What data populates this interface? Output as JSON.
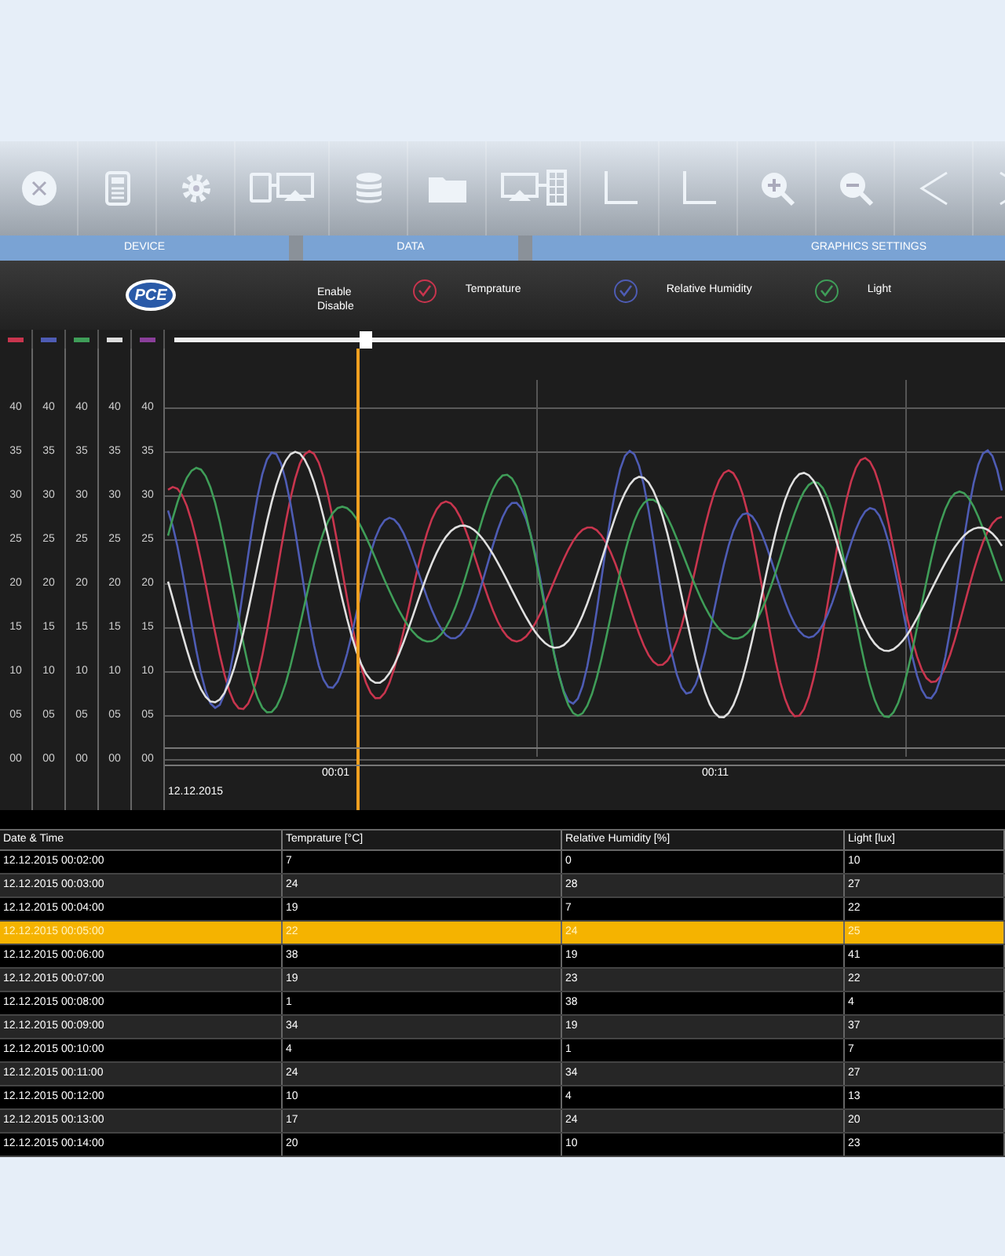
{
  "sections": [
    "DEVICE",
    "DATA",
    "GRAPHICS SETTINGS"
  ],
  "logo_text": "PCE",
  "enable_label": "Enable",
  "disable_label": "Disable",
  "series": [
    {
      "name": "Temprature",
      "color": "#c8354e",
      "checked": true
    },
    {
      "name": "Relative Humidity",
      "color": "#4e5cb4",
      "checked": true
    },
    {
      "name": "Light",
      "color": "#3f9d58",
      "checked": true
    }
  ],
  "slider": {
    "level": 0.23
  },
  "axis_columns": [
    {
      "color": "#c8354e",
      "ticks": [
        "40",
        "35",
        "30",
        "25",
        "20",
        "15",
        "10",
        "05",
        "00"
      ]
    },
    {
      "color": "#4e5cb4",
      "ticks": [
        "40",
        "35",
        "30",
        "25",
        "20",
        "15",
        "10",
        "05",
        "00"
      ]
    },
    {
      "color": "#3f9d58",
      "ticks": [
        "40",
        "35",
        "30",
        "25",
        "20",
        "15",
        "10",
        "05",
        "00"
      ]
    },
    {
      "color": "#dddddd",
      "ticks": [
        "40",
        "35",
        "30",
        "25",
        "20",
        "15",
        "10",
        "05",
        "00"
      ]
    },
    {
      "color": "#8a3f9a",
      "ticks": [
        "40",
        "35",
        "30",
        "25",
        "20",
        "15",
        "10",
        "05",
        "00"
      ]
    }
  ],
  "time_labels": [
    "00:01",
    "00:11"
  ],
  "date_label": "12.12.2015",
  "table": {
    "columns": [
      "Date & Time",
      "Temprature [°C]",
      "Relative Humidity [%]",
      "Light [lux]"
    ],
    "rows": [
      {
        "cells": [
          "12.12.2015 00:02:00",
          "7",
          "0",
          "10"
        ],
        "selected": false
      },
      {
        "cells": [
          "12.12.2015 00:03:00",
          "24",
          "28",
          "27"
        ],
        "selected": false
      },
      {
        "cells": [
          "12.12.2015 00:04:00",
          "19",
          "7",
          "22"
        ],
        "selected": false
      },
      {
        "cells": [
          "12.12.2015 00:05:00",
          "22",
          "24",
          "25"
        ],
        "selected": true
      },
      {
        "cells": [
          "12.12.2015 00:06:00",
          "38",
          "19",
          "41"
        ],
        "selected": false
      },
      {
        "cells": [
          "12.12.2015 00:07:00",
          "19",
          "23",
          "22"
        ],
        "selected": false
      },
      {
        "cells": [
          "12.12.2015 00:08:00",
          "1",
          "38",
          "4"
        ],
        "selected": false
      },
      {
        "cells": [
          "12.12.2015 00:09:00",
          "34",
          "19",
          "37"
        ],
        "selected": false
      },
      {
        "cells": [
          "12.12.2015 00:10:00",
          "4",
          "1",
          "7"
        ],
        "selected": false
      },
      {
        "cells": [
          "12.12.2015 00:11:00",
          "24",
          "34",
          "27"
        ],
        "selected": false
      },
      {
        "cells": [
          "12.12.2015 00:12:00",
          "10",
          "4",
          "13"
        ],
        "selected": false
      },
      {
        "cells": [
          "12.12.2015 00:13:00",
          "17",
          "24",
          "20"
        ],
        "selected": false
      },
      {
        "cells": [
          "12.12.2015 00:14:00",
          "20",
          "10",
          "23"
        ],
        "selected": false
      }
    ]
  }
}
